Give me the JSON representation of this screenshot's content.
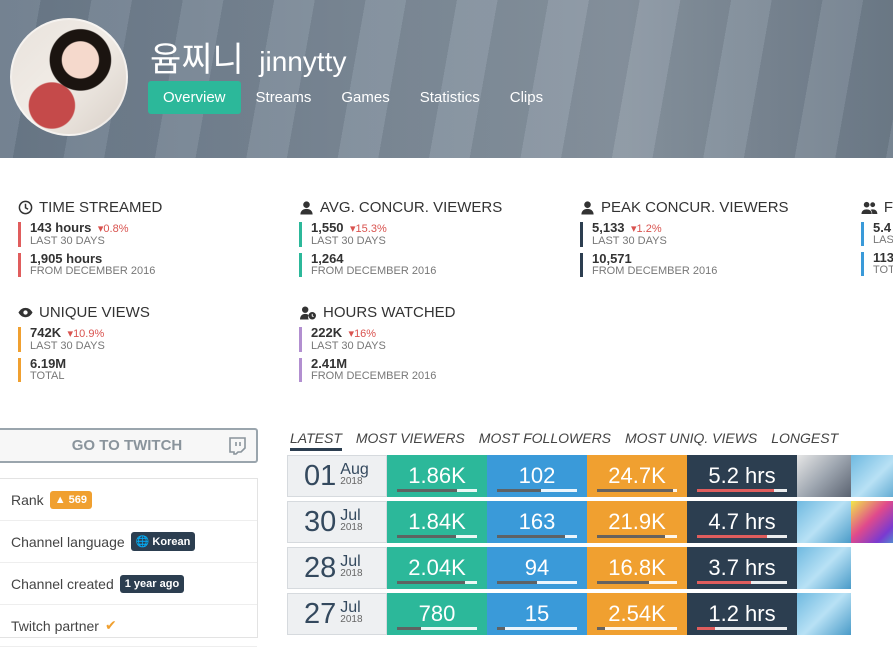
{
  "channel": {
    "display_name": "윰찌니",
    "login": "jinnytty"
  },
  "nav": [
    "Overview",
    "Streams",
    "Games",
    "Statistics",
    "Clips"
  ],
  "stats": {
    "time_streamed": {
      "title": "TIME STREAMED",
      "recent_value": "143 hours",
      "recent_change": "0.8%",
      "recent_label": "LAST 30 DAYS",
      "total_value": "1,905 hours",
      "total_label": "FROM DECEMBER 2016"
    },
    "avg_viewers": {
      "title": "AVG. CONCUR. VIEWERS",
      "recent_value": "1,550",
      "recent_change": "15.3%",
      "recent_label": "LAST 30 DAYS",
      "total_value": "1,264",
      "total_label": "FROM DECEMBER 2016"
    },
    "peak_viewers": {
      "title": "PEAK CONCUR. VIEWERS",
      "recent_value": "5,133",
      "recent_change": "1.2%",
      "recent_label": "LAST 30 DAYS",
      "total_value": "10,571",
      "total_label": "FROM DECEMBER 2016"
    },
    "followers": {
      "title": "F",
      "recent_value": "5.4",
      "recent_label": "LAS",
      "total_value": "113",
      "total_label": "TOT"
    },
    "unique_views": {
      "title": "UNIQUE VIEWS",
      "recent_value": "742K",
      "recent_change": "10.9%",
      "recent_label": "LAST 30 DAYS",
      "total_value": "6.19M",
      "total_label": "TOTAL"
    },
    "hours_watched": {
      "title": "HOURS WATCHED",
      "recent_value": "222K",
      "recent_change": "16%",
      "recent_label": "LAST 30 DAYS",
      "total_value": "2.41M",
      "total_label": "FROM DECEMBER 2016"
    }
  },
  "sidebar": {
    "go_to_twitch": "GO TO TWITCH",
    "rank_label": "Rank",
    "rank_value": "569",
    "language_label": "Channel language",
    "language_value": "Korean",
    "created_label": "Channel created",
    "created_value": "1 year ago",
    "partner_label": "Twitch partner"
  },
  "stream_tabs": [
    "LATEST",
    "MOST VIEWERS",
    "MOST FOLLOWERS",
    "MOST UNIQ. VIEWS",
    "LONGEST"
  ],
  "streams": [
    {
      "day": "01",
      "month": "Aug",
      "year": "2018",
      "avg_viewers": "1.86K",
      "followers": "102",
      "views": "24.7K",
      "duration": "5.2 hrs",
      "fills": [
        0.75,
        0.55,
        0.95,
        0.85
      ]
    },
    {
      "day": "30",
      "month": "Jul",
      "year": "2018",
      "avg_viewers": "1.84K",
      "followers": "163",
      "views": "21.9K",
      "duration": "4.7 hrs",
      "fills": [
        0.74,
        0.85,
        0.85,
        0.78
      ]
    },
    {
      "day": "28",
      "month": "Jul",
      "year": "2018",
      "avg_viewers": "2.04K",
      "followers": "94",
      "views": "16.8K",
      "duration": "3.7 hrs",
      "fills": [
        0.85,
        0.5,
        0.65,
        0.6
      ]
    },
    {
      "day": "27",
      "month": "Jul",
      "year": "2018",
      "avg_viewers": "780",
      "followers": "15",
      "views": "2.54K",
      "duration": "1.2 hrs",
      "fills": [
        0.3,
        0.1,
        0.1,
        0.2
      ]
    }
  ]
}
